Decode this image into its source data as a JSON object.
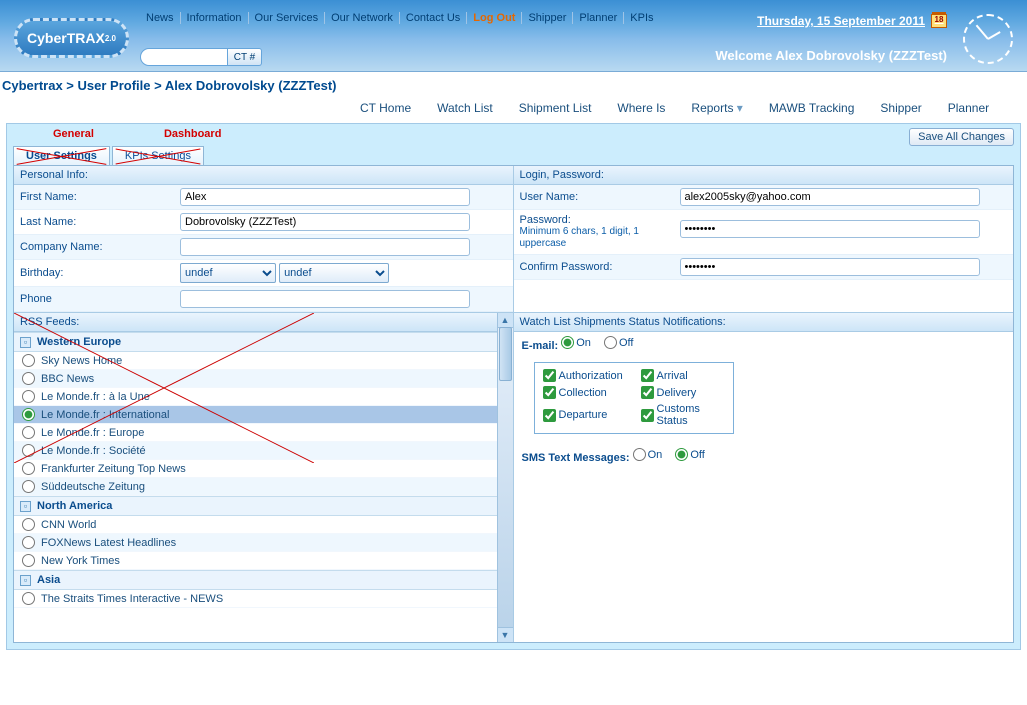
{
  "brand": {
    "name": "CyberTRAX",
    "ver": "2.0"
  },
  "topnav": {
    "items": [
      "News",
      "Information",
      "Our Services",
      "Our Network",
      "Contact Us",
      "Log Out",
      "Shipper",
      "Planner",
      "KPIs"
    ],
    "logout_index": 5,
    "search_btn": "CT #"
  },
  "header": {
    "date": "Thursday, 15 September 2011",
    "cal_day": "18",
    "welcome": "Welcome Alex Dobrovolsky (ZZZTest)"
  },
  "breadcrumb": "Cybertrax > User Profile > Alex Dobrovolsky (ZZZTest)",
  "nav2": [
    "CT Home",
    "Watch List",
    "Shipment List",
    "Where Is",
    "Reports",
    "MAWB Tracking",
    "Shipper",
    "Planner"
  ],
  "nav2_dropdown_index": 4,
  "save_all": "Save All Changes",
  "rename": {
    "tab1": "General",
    "tab2": "Dashboard"
  },
  "tabs": {
    "active": "User Settings",
    "other": "KPIs Settings"
  },
  "personal": {
    "header": "Personal Info:",
    "first_label": "First Name:",
    "first": "Alex",
    "last_label": "Last Name:",
    "last": "Dobrovolsky (ZZZTest)",
    "company_label": "Company Name:",
    "company": "",
    "birthday_label": "Birthday:",
    "bday_m": "undef",
    "bday_d": "undef",
    "phone_label": "Phone",
    "phone": ""
  },
  "login": {
    "header": "Login, Password:",
    "user_label": "User Name:",
    "user": "alex2005sky@yahoo.com",
    "pass_label": "Password:",
    "pass": "••••••••",
    "hint": "Minimum 6 chars, 1 digit, 1 uppercase",
    "confirm_label": "Confirm Password:",
    "confirm": "••••••••"
  },
  "rss": {
    "header": "RSS Feeds:",
    "groups": [
      {
        "title": "Western Europe",
        "items": [
          {
            "label": "Sky News Home",
            "sel": false
          },
          {
            "label": "BBC News",
            "sel": false
          },
          {
            "label": "Le Monde.fr : à la Une",
            "sel": false
          },
          {
            "label": "Le Monde.fr : International",
            "sel": true
          },
          {
            "label": "Le Monde.fr : Europe",
            "sel": false
          },
          {
            "label": "Le Monde.fr : Société",
            "sel": false
          },
          {
            "label": "Frankfurter Zeitung Top News",
            "sel": false
          },
          {
            "label": "Süddeutsche Zeitung",
            "sel": false
          }
        ]
      },
      {
        "title": "North America",
        "items": [
          {
            "label": "CNN World",
            "sel": false
          },
          {
            "label": "FOXNews Latest Headlines",
            "sel": false
          },
          {
            "label": "New York Times",
            "sel": false
          }
        ]
      },
      {
        "title": "Asia",
        "items": [
          {
            "label": "The Straits Times Interactive - NEWS",
            "sel": false
          }
        ]
      }
    ]
  },
  "notif": {
    "header": "Watch List Shipments Status Notifications:",
    "email_label": "E-mail:",
    "on": "On",
    "off": "Off",
    "email_on": true,
    "checks": [
      {
        "label": "Authorization",
        "on": true
      },
      {
        "label": "Arrival",
        "on": true
      },
      {
        "label": "Collection",
        "on": true
      },
      {
        "label": "Delivery",
        "on": true
      },
      {
        "label": "Departure",
        "on": true
      },
      {
        "label": "Customs Status",
        "on": true
      }
    ],
    "sms_label": "SMS Text Messages:",
    "sms_on": false
  }
}
